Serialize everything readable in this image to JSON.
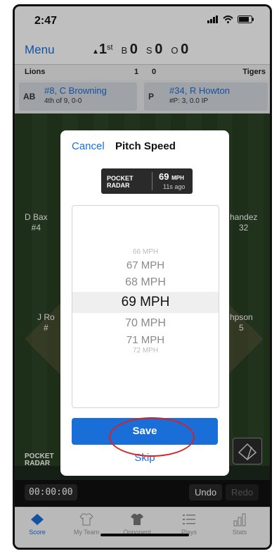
{
  "status": {
    "time": "2:47"
  },
  "topbar": {
    "menu_label": "Menu",
    "inning_num": "1",
    "inning_suffix": "st",
    "balls_label": "B",
    "balls": "0",
    "strikes_label": "S",
    "strikes": "0",
    "outs_label": "O",
    "outs": "0"
  },
  "scoreboard": {
    "away_team": "Lions",
    "inning_away": "1",
    "inning_home": "0",
    "home_team": "Tigers"
  },
  "batter": {
    "tag": "AB",
    "name": "#8, C Browning",
    "detail": "4th of 9, 0-0"
  },
  "pitcher": {
    "tag": "P",
    "name": "#34, R Howton",
    "detail": "#P: 3, 0.0 IP"
  },
  "field_players": {
    "left_name": "D Bax",
    "left_num": "#4",
    "right_name": "handez",
    "right_num": "32",
    "left2_name": "J Ro",
    "left2_num": "#",
    "right2_name": "hpson",
    "right2_num": "5"
  },
  "bottom_logo": {
    "line1": "POCKET",
    "line2": "RADAR"
  },
  "controls": {
    "clock": "00:00:00",
    "undo": "Undo",
    "redo": "Redo"
  },
  "tabs": [
    {
      "label": "Score"
    },
    {
      "label": "My Team"
    },
    {
      "label": "Opponent"
    },
    {
      "label": "Plays"
    },
    {
      "label": "Stats"
    }
  ],
  "modal": {
    "cancel": "Cancel",
    "title": "Pitch Speed",
    "radar": {
      "brand1": "POCKET",
      "brand2": "RADAR",
      "speed": "69",
      "unit": "MPH",
      "ago": "11s ago"
    },
    "options": [
      "66 MPH",
      "67 MPH",
      "68 MPH",
      "69 MPH",
      "70 MPH",
      "71 MPH",
      "72 MPH"
    ],
    "save": "Save",
    "skip": "Skip"
  },
  "colors": {
    "accent": "#1a6ed8",
    "annotation": "#d82222"
  }
}
